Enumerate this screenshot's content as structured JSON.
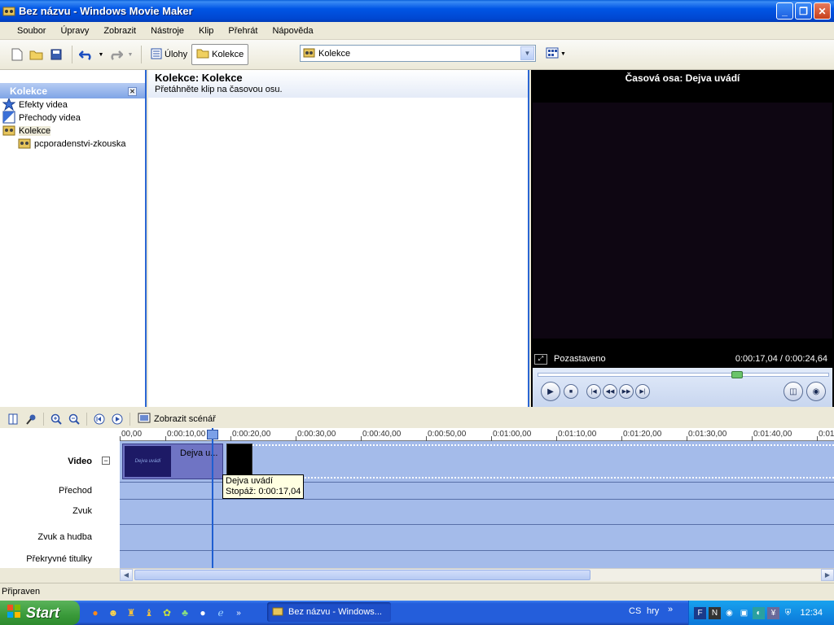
{
  "window": {
    "title": "Bez názvu - Windows Movie Maker",
    "minimize": "_",
    "maximize": "❐",
    "close": "✕"
  },
  "menu": [
    "Soubor",
    "Úpravy",
    "Zobrazit",
    "Nástroje",
    "Klip",
    "Přehrát",
    "Nápověda"
  ],
  "toolbar": {
    "tasks_label": "Úlohy",
    "collections_label": "Kolekce",
    "collection_combo_value": "Kolekce"
  },
  "left_pane": {
    "header": "Kolekce",
    "items": [
      {
        "label": "Efekty videa"
      },
      {
        "label": "Přechody videa"
      },
      {
        "label": "Kolekce"
      },
      {
        "label": "pcporadenstvi-zkouska"
      }
    ]
  },
  "content": {
    "title": "Kolekce: Kolekce",
    "subtitle": "Přetáhněte klip na časovou osu."
  },
  "preview": {
    "title": "Časová osa: Dejva uvádí",
    "status": "Pozastaveno",
    "time": "0:00:17,04 / 0:00:24,64",
    "position_fraction": 0.69
  },
  "timeline": {
    "storyboard_label": "Zobrazit scénář",
    "ruler_ticks": [
      "00,00",
      "0:00:10,00",
      "0:00:20,00",
      "0:00:30,00",
      "0:00:40,00",
      "0:00:50,00",
      "0:01:00,00",
      "0:01:10,00",
      "0:01:20,00",
      "0:01:30,00",
      "0:01:40,00",
      "0:01"
    ],
    "tracks": {
      "video": "Video",
      "transition": "Přechod",
      "audio": "Zvuk",
      "audio_music": "Zvuk a hudba",
      "overlay": "Překryvné titulky"
    },
    "clip": {
      "name": "Dejva u...",
      "thumb_text": "Dejva uvádí"
    },
    "tooltip": {
      "name": "Dejva uvádí",
      "duration": "Stopáž:  0:00:17,04"
    }
  },
  "statusbar": {
    "text": "Připraven"
  },
  "taskbar": {
    "start": "Start",
    "task": "Bez názvu - Windows...",
    "language": "CS",
    "hry": "hry",
    "clock": "12:34"
  }
}
